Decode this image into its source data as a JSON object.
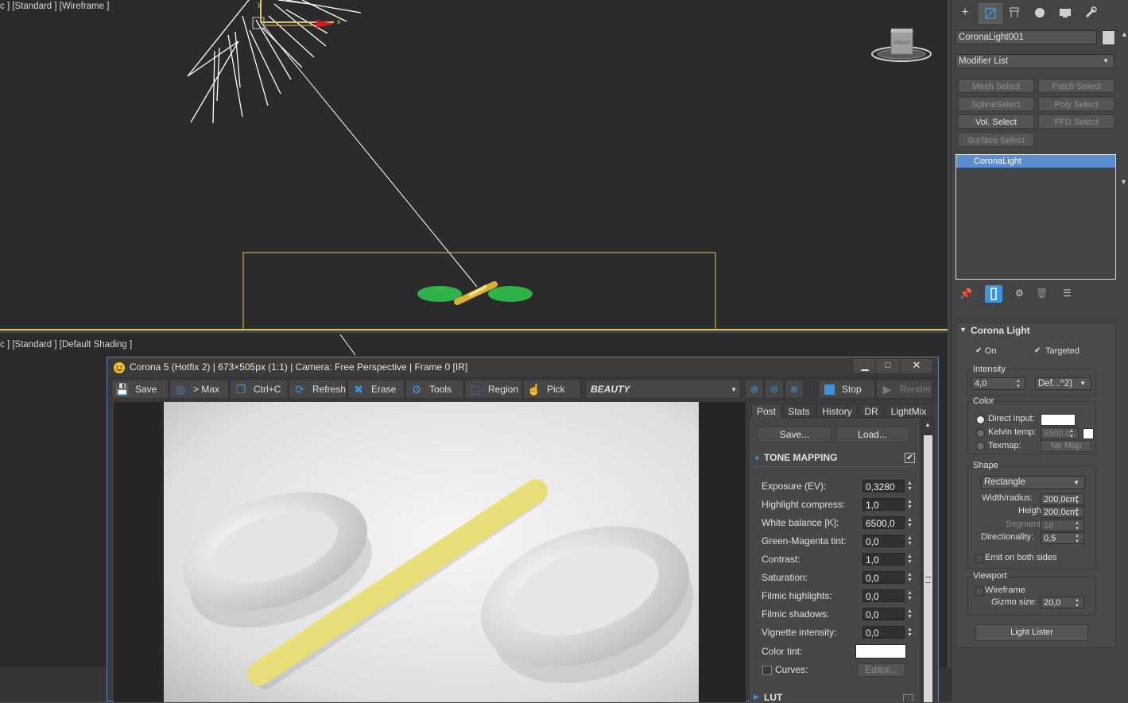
{
  "viewports": {
    "top_label": "c ] [Standard ] [Wireframe ]",
    "bottom_label": "c ] [Standard ] [Default Shading ]",
    "viewcube_label": "FRONT"
  },
  "command_panel": {
    "object_name": "CoronaLight001",
    "modifier_list": "Modifier List",
    "modifier_buttons": [
      {
        "label": "Mesh Select",
        "enabled": false
      },
      {
        "label": "Patch Select",
        "enabled": false
      },
      {
        "label": "SplineSelect",
        "enabled": false
      },
      {
        "label": "Poly Select",
        "enabled": false
      },
      {
        "label": "Vol. Select",
        "enabled": true
      },
      {
        "label": "FFD Select",
        "enabled": false
      },
      {
        "label": "Surface Select",
        "enabled": false
      }
    ],
    "stack_item": "CoronaLight",
    "rollout_title": "Corona Light",
    "on_label": "On",
    "targeted_label": "Targeted",
    "intensity_label": "Intensity",
    "intensity_value": "4,0",
    "intensity_unit": "Def...^2)",
    "color_label": "Color",
    "direct_input_label": "Direct input:",
    "kelvin_label": "Kelvin temp:",
    "kelvin_value": "6500,0",
    "texmap_label": "Texmap:",
    "no_map": "No Map",
    "shape_label": "Shape",
    "shape_value": "Rectangle",
    "width_label": "Width/radius:",
    "width_value": "200,0cm",
    "height_label": "Height:",
    "height_value": "200,0cm",
    "segments_label": "Segments:",
    "segments_value": "16",
    "directionality_label": "Directionality:",
    "directionality_value": "0,5",
    "emit_both_label": "Emit on both sides",
    "viewport_label": "Viewport",
    "wireframe_label": "Wireframe",
    "gizmo_label": "Gizmo size:",
    "gizmo_value": "20,0",
    "light_lister": "Light Lister"
  },
  "vfb": {
    "title": "Corona 5 (Hotfix 2) | 673×505px (1:1) | Camera: Free Perspective | Frame 0 [IR]",
    "toolbar": {
      "save": "Save",
      "to_max": "> Max",
      "copy": "Ctrl+C",
      "refresh": "Refresh",
      "erase": "Erase",
      "tools": "Tools",
      "region": "Region",
      "pick": "Pick",
      "channel": "BEAUTY",
      "stop": "Stop",
      "render": "Render"
    },
    "tabs": [
      "Post",
      "Stats",
      "History",
      "DR",
      "LightMix"
    ],
    "save_btn": "Save...",
    "load_btn": "Load...",
    "section": "TONE MAPPING",
    "section2": "LUT",
    "params": [
      {
        "label": "Exposure (EV):",
        "value": "0,3280"
      },
      {
        "label": "Highlight compress:",
        "value": "1,0"
      },
      {
        "label": "White balance [K]:",
        "value": "6500,0"
      },
      {
        "label": "Green-Magenta tint:",
        "value": "0,0"
      },
      {
        "label": "Contrast:",
        "value": "1,0"
      },
      {
        "label": "Saturation:",
        "value": "0,0"
      },
      {
        "label": "Filmic highlights:",
        "value": "0,0"
      },
      {
        "label": "Filmic shadows:",
        "value": "0,0"
      },
      {
        "label": "Vignette intensity:",
        "value": "0,0"
      }
    ],
    "color_tint_label": "Color tint:",
    "curves_label": "Curves:",
    "editor_btn": "Editor..."
  },
  "colors": {
    "viewport_bg": "#2b2b2b",
    "selection_yellow": "#e3c267",
    "accent_blue": "#3c93e0",
    "light_green": "#2fb24a"
  }
}
